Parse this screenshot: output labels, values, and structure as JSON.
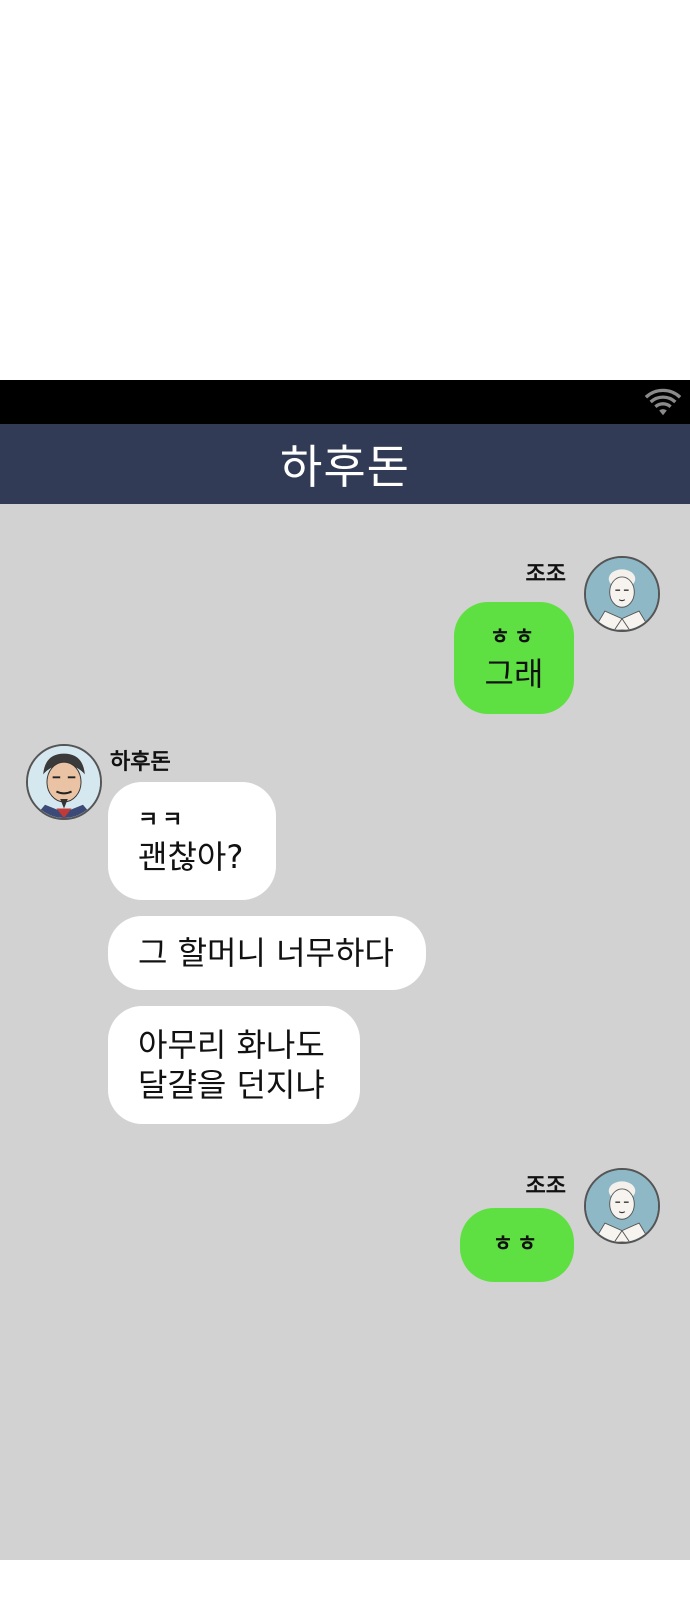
{
  "header": {
    "title": "하후돈"
  },
  "messages": [
    {
      "sender": "조조",
      "side": "right",
      "lines": [
        "ㅎㅎ",
        "그래"
      ]
    },
    {
      "sender": "하후돈",
      "side": "left",
      "lines": [
        "ㅋㅋ",
        "괜찮아?"
      ]
    },
    {
      "side": "left",
      "lines": [
        "그 할머니 너무하다"
      ]
    },
    {
      "side": "left",
      "lines": [
        "아무리 화나도",
        "달걀을 던지냐"
      ]
    },
    {
      "sender": "조조",
      "side": "right",
      "lines": [
        "ㅎㅎ"
      ]
    }
  ],
  "colors": {
    "header_bg": "#323b55",
    "chat_bg": "#d2d2d2",
    "my_bubble": "#5fe042",
    "their_bubble": "#ffffff"
  }
}
